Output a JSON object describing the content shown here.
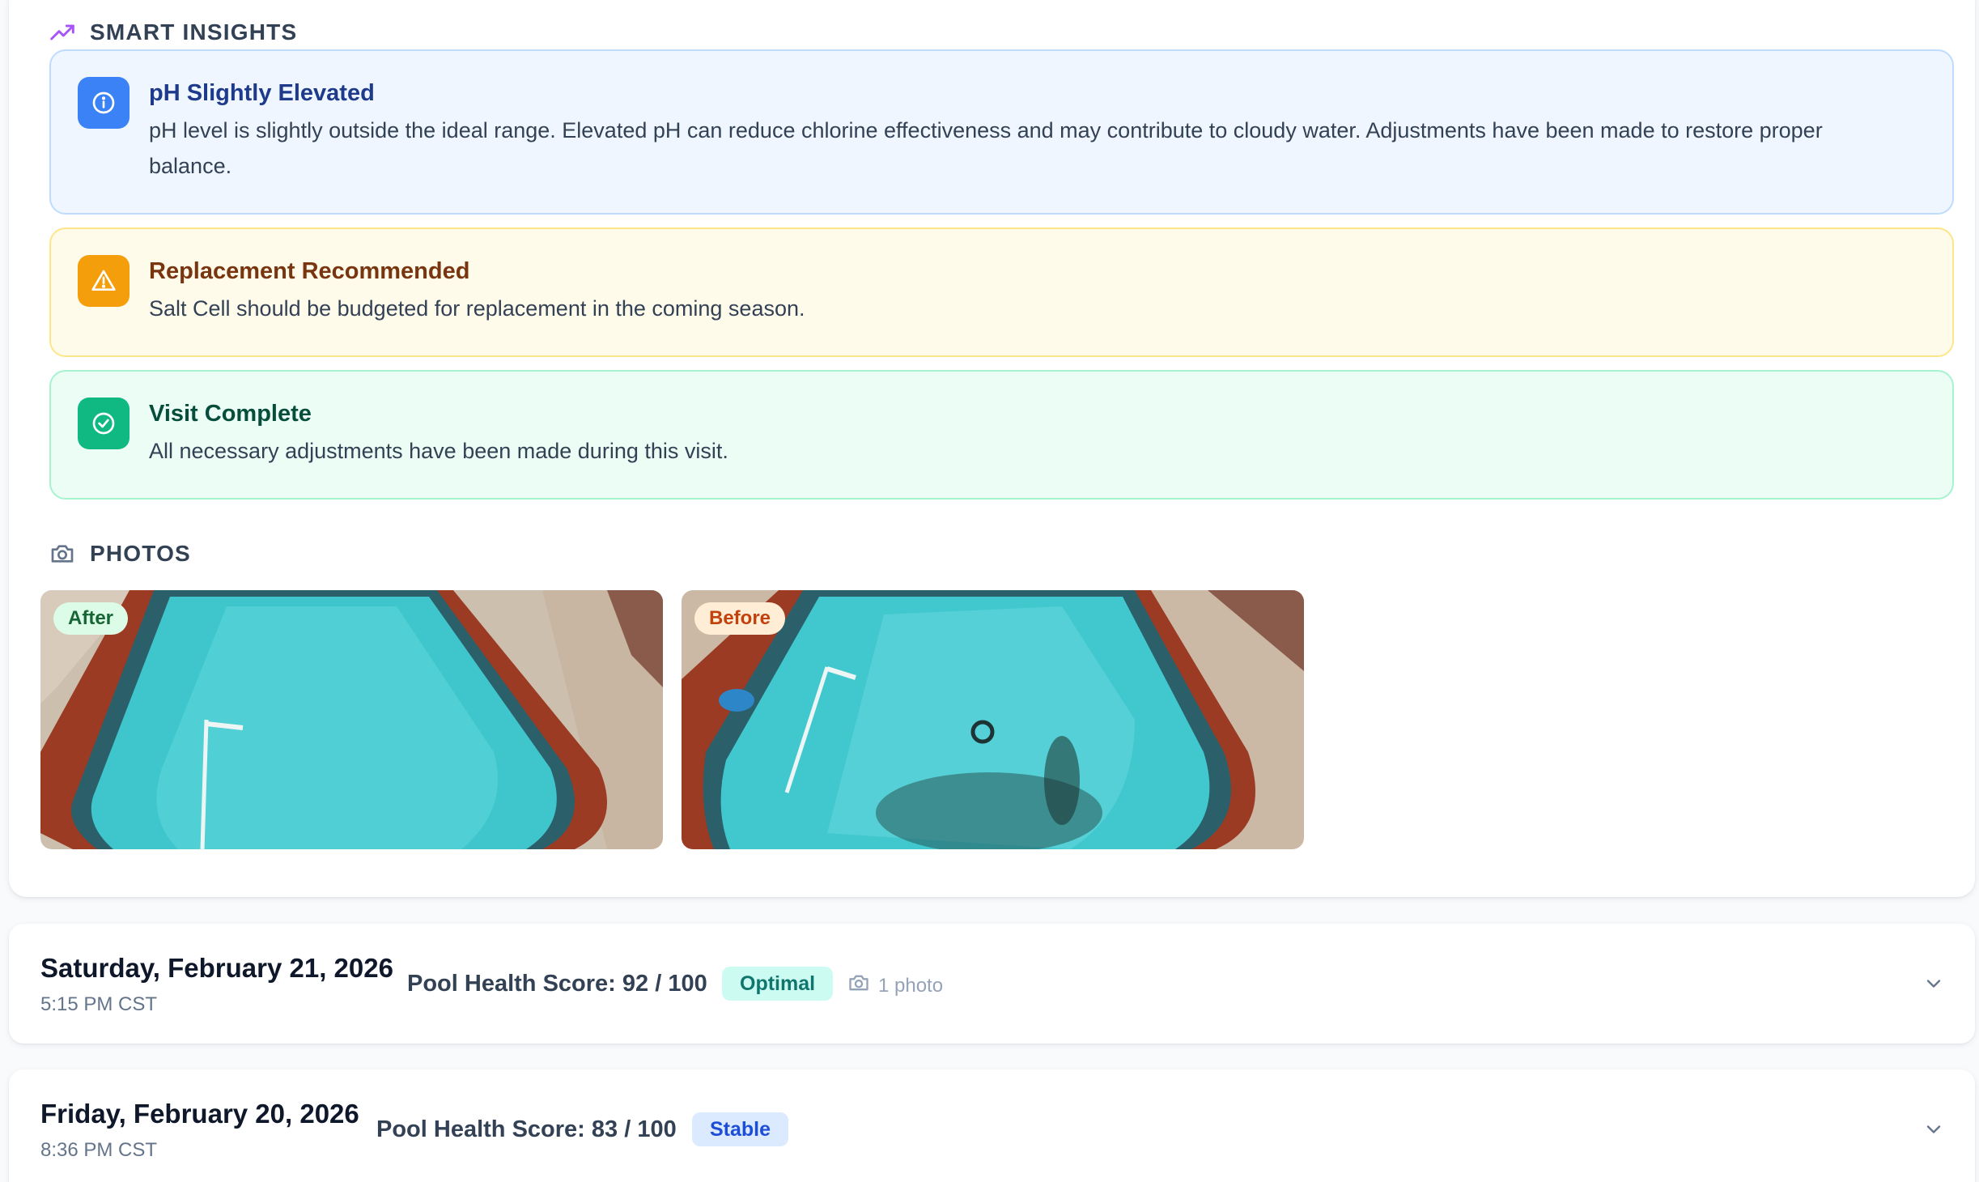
{
  "insights": {
    "header": "SMART INSIGHTS",
    "header_icon": "trending-up-icon",
    "items": [
      {
        "title": "pH Slightly Elevated",
        "body": "pH level is slightly outside the ideal range. Elevated pH can reduce chlorine effectiveness and may contribute to cloudy water. Adjustments have been made to restore proper balance.",
        "icon": "info-icon",
        "color": "#3b82f6"
      },
      {
        "title": "Replacement Recommended",
        "body": "Salt Cell should be budgeted for replacement in the coming season.",
        "icon": "warning-icon",
        "color": "#f59e0b"
      },
      {
        "title": "Visit Complete",
        "body": "All necessary adjustments have been made during this visit.",
        "icon": "check-circle-icon",
        "color": "#10b981"
      }
    ]
  },
  "photos": {
    "header": "PHOTOS",
    "header_icon": "camera-icon",
    "items": [
      {
        "label": "After"
      },
      {
        "label": "Before"
      }
    ]
  },
  "visits": [
    {
      "date": "Saturday, February 21, 2026",
      "time": "5:15 PM CST",
      "score": "Pool Health Score: 92 / 100",
      "status": "Optimal",
      "photo_count": "1 photo"
    },
    {
      "date": "Friday, February 20, 2026",
      "time": "8:36 PM CST",
      "score": "Pool Health Score: 83 / 100",
      "status": "Stable"
    }
  ]
}
